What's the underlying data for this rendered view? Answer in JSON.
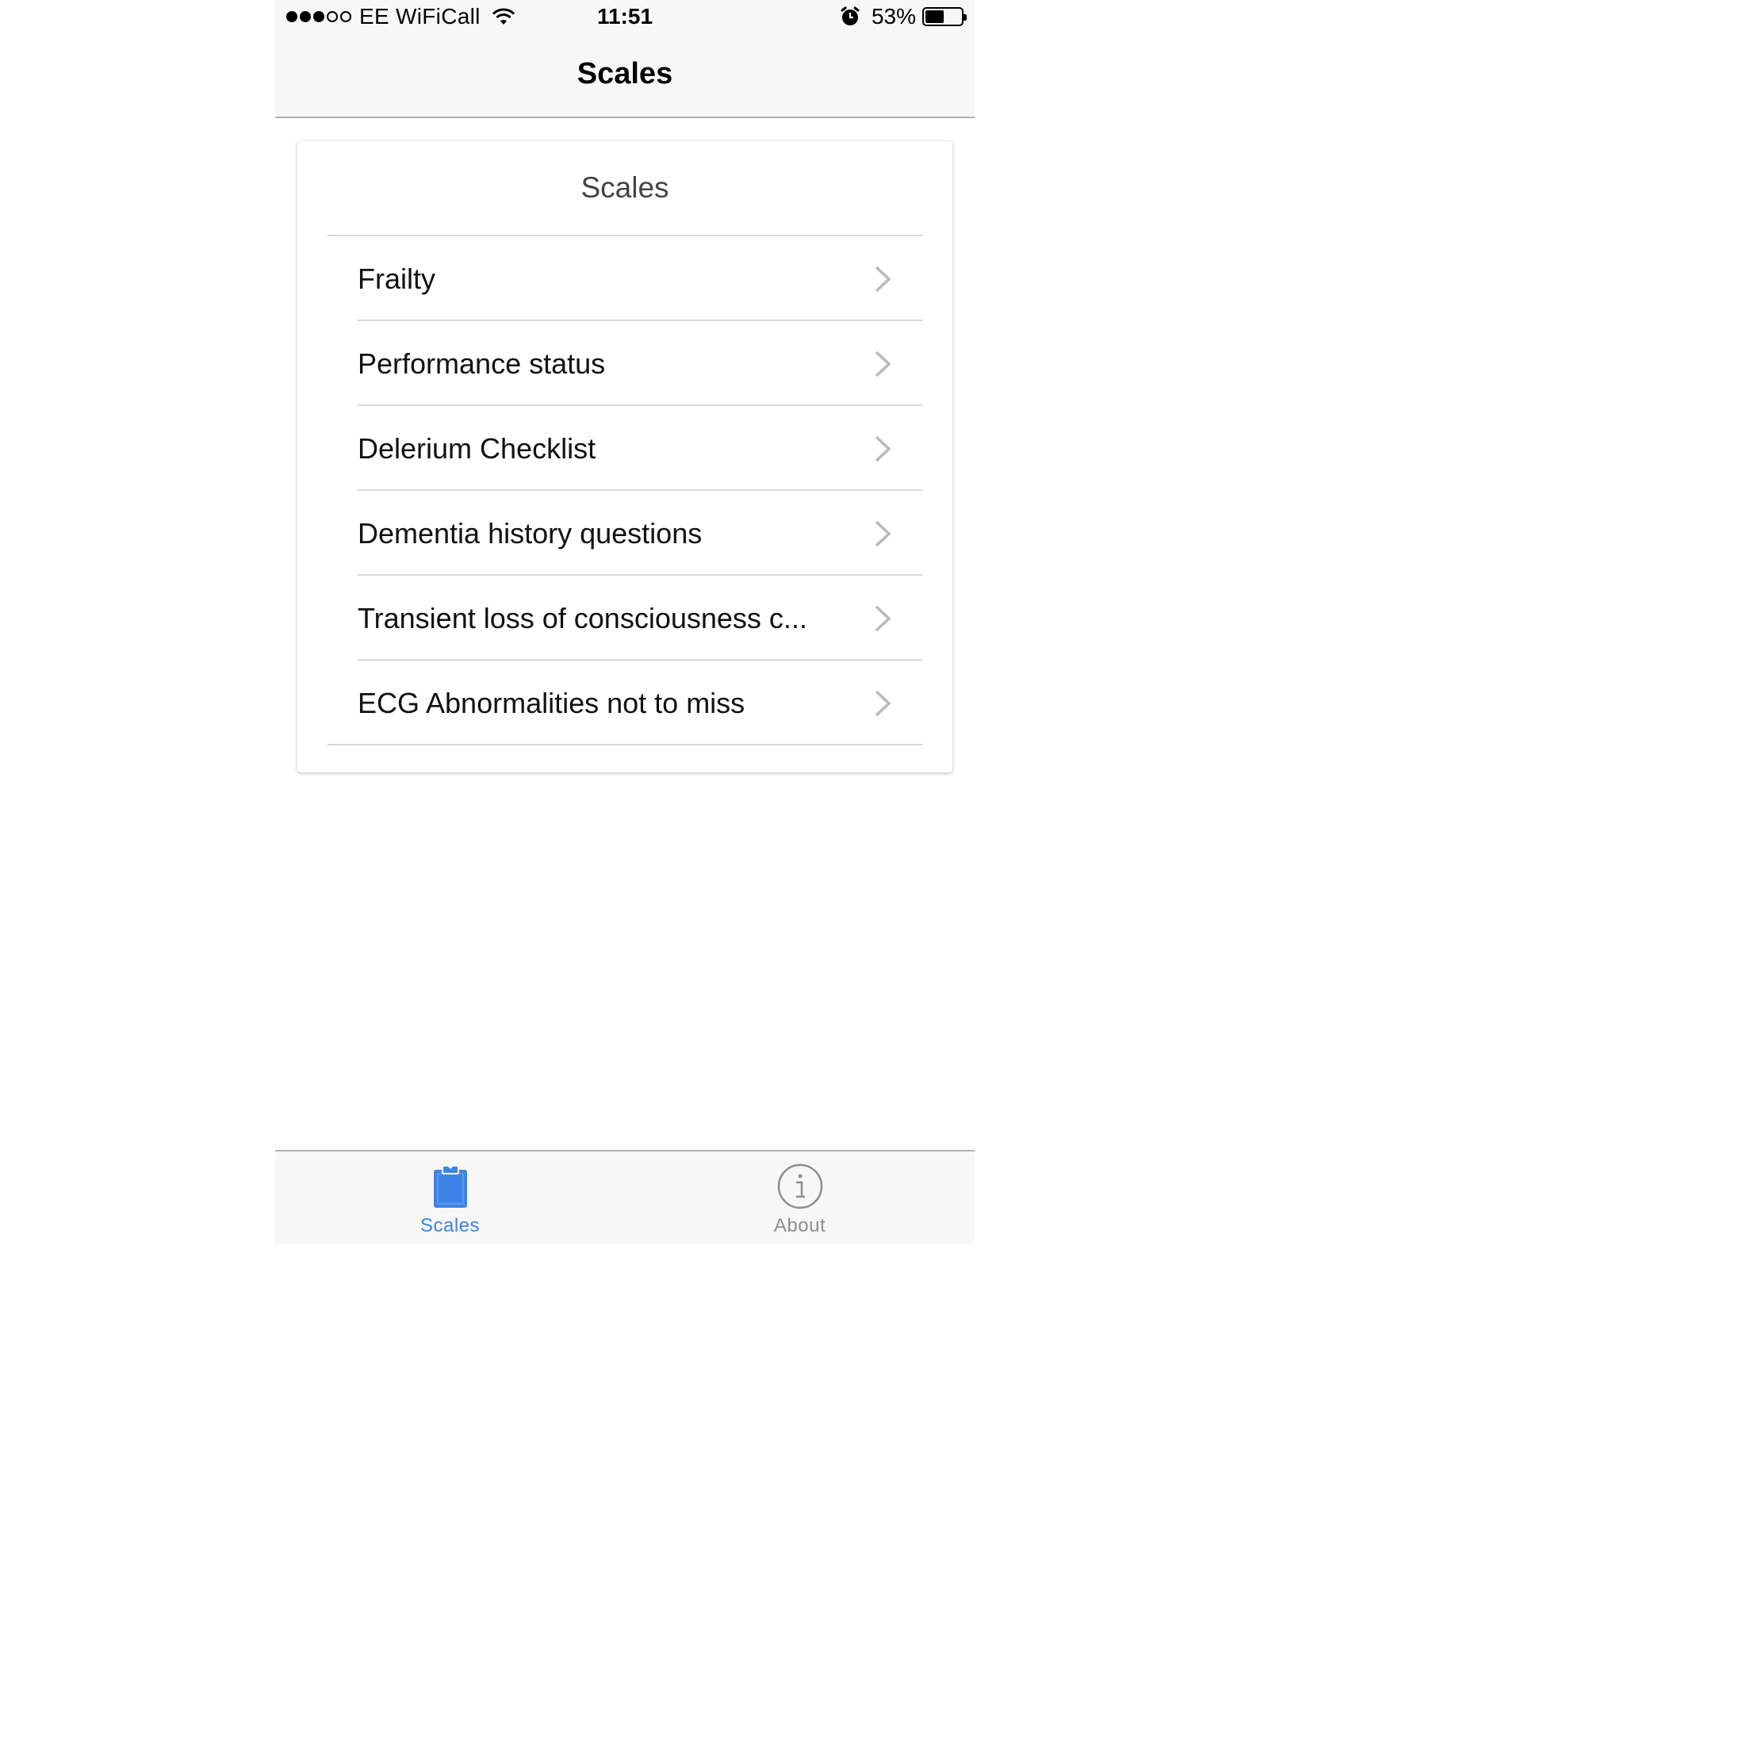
{
  "status_bar": {
    "carrier": "EE WiFiCall",
    "time": "11:51",
    "battery_percent": "53%",
    "battery_level": 0.53,
    "signal_bars_filled": 3,
    "signal_bars_total": 5
  },
  "nav": {
    "title": "Scales"
  },
  "card": {
    "header": "Scales",
    "items": [
      {
        "label": "Frailty"
      },
      {
        "label": "Performance status"
      },
      {
        "label": "Delerium Checklist"
      },
      {
        "label": "Dementia history questions"
      },
      {
        "label": "Transient loss of consciousness c..."
      },
      {
        "label": "ECG Abnormalities not to miss"
      }
    ]
  },
  "tabbar": {
    "tabs": [
      {
        "label": "Scales",
        "icon": "clipboard-icon",
        "active": true
      },
      {
        "label": "About",
        "icon": "info-icon",
        "active": false
      }
    ]
  },
  "colors": {
    "accent": "#3e84e6",
    "inactive_tab": "#8e8e8e",
    "bar_background": "#f7f7f7",
    "separator": "#d8d8d8"
  }
}
